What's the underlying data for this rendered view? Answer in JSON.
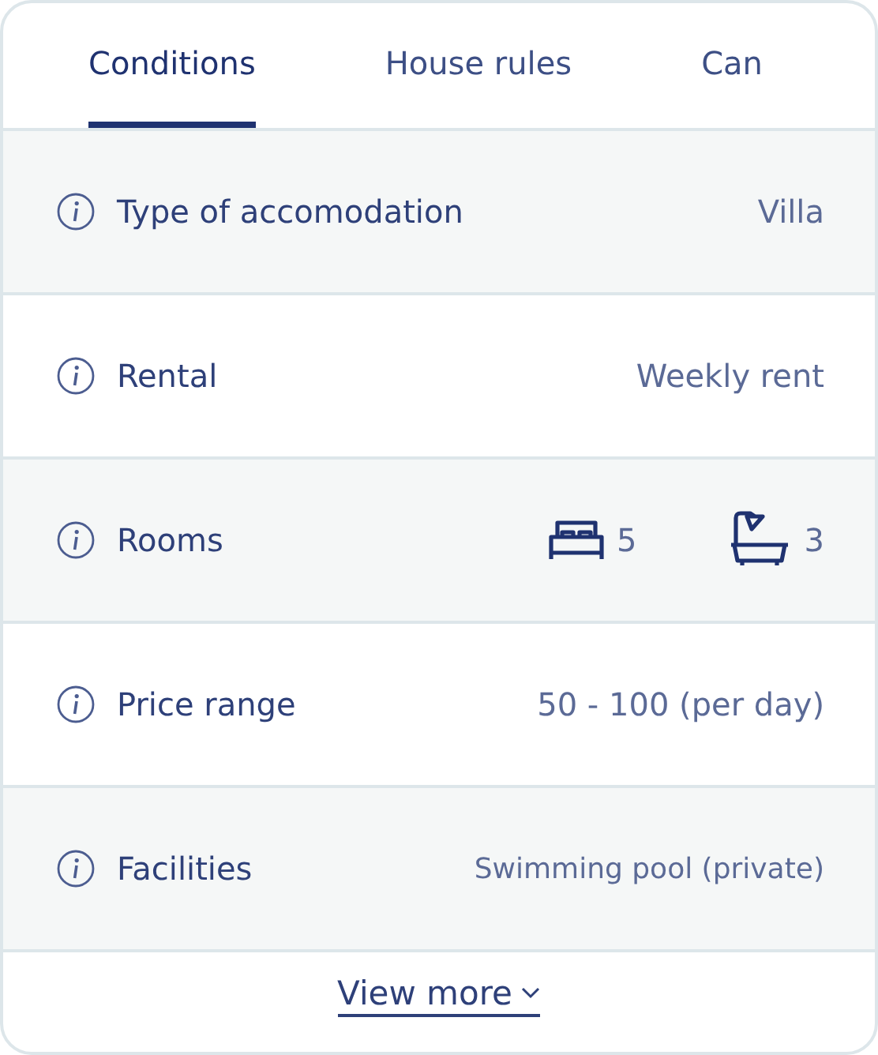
{
  "tabs": [
    {
      "label": "Conditions",
      "selected": true
    },
    {
      "label": "House rules",
      "selected": false
    },
    {
      "label": "Can",
      "selected": false
    }
  ],
  "rows": [
    {
      "kind": "text",
      "label": "Type of accomodation",
      "value": "Villa"
    },
    {
      "kind": "text",
      "label": "Rental",
      "value": "Weekly rent"
    },
    {
      "kind": "rooms",
      "label": "Rooms",
      "bedrooms": "5",
      "bathrooms": "3"
    },
    {
      "kind": "text",
      "label": "Price range",
      "value": "50 - 100 (per day)"
    },
    {
      "kind": "text",
      "label": "Facilities",
      "value": "Swimming pool (private)"
    }
  ],
  "view_more": "View more"
}
